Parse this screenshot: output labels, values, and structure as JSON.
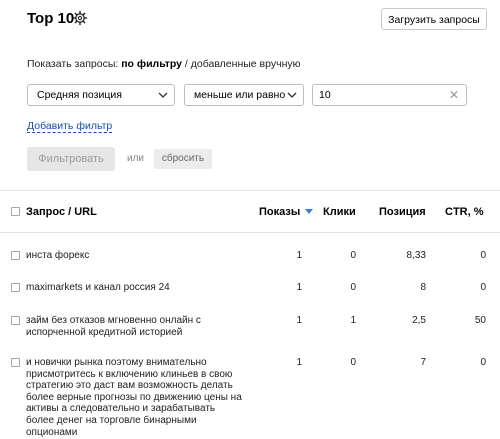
{
  "header": {
    "title": "Top 10",
    "upload_button": "Загрузить запросы"
  },
  "filter": {
    "show_label": "Показать запросы:",
    "by_filter": "по фильтру",
    "separator": "/",
    "manual": "добавленные вручную",
    "field_select": "Средняя позиция",
    "operator_select": "меньше или равно",
    "value": "10",
    "add_filter": "Добавить фильтр",
    "apply_button": "Фильтровать",
    "or_label": "или",
    "reset_button": "сбросить"
  },
  "table": {
    "columns": [
      "Запрос / URL",
      "Показы",
      "Клики",
      "Позиция",
      "CTR, %"
    ],
    "rows": [
      {
        "query": "инста форекс",
        "shows": "1",
        "clicks": "0",
        "position": "8,33",
        "ctr": "0"
      },
      {
        "query": "maximarkets и канал россия 24",
        "shows": "1",
        "clicks": "0",
        "position": "8",
        "ctr": "0"
      },
      {
        "query_lines": [
          "займ без отказов мгновенно онлайн с",
          "испорченной кредитной историей"
        ],
        "shows": "1",
        "clicks": "1",
        "position": "2,5",
        "ctr": "50"
      },
      {
        "query_lines": [
          "и новички рынка поэтому внимательно",
          "присмотритесь к включению клиньев в свою",
          "стратегию это даст вам возможность делать",
          "более верные прогнозы по движению цены на",
          "активы а следовательно и зарабатывать",
          "более денег на торговле бинарными",
          "опционами"
        ],
        "shows": "1",
        "clicks": "0",
        "position": "7",
        "ctr": "0"
      }
    ]
  }
}
